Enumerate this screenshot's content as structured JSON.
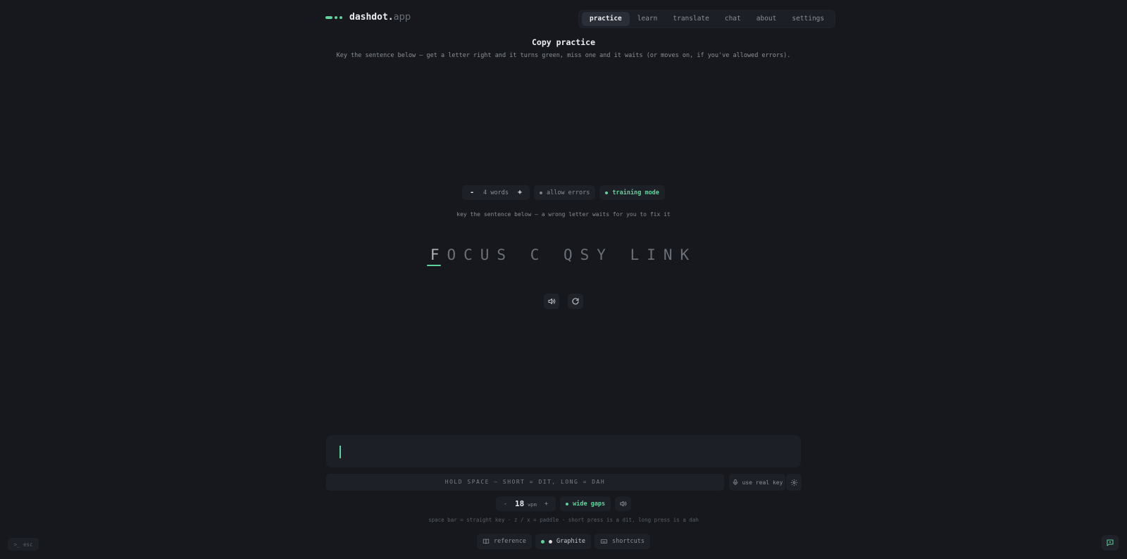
{
  "header": {
    "logo_name": "dashdot.",
    "logo_tld": "app",
    "tabs": [
      {
        "label": "practice",
        "active": true
      },
      {
        "label": "learn"
      },
      {
        "label": "translate"
      },
      {
        "label": "chat"
      },
      {
        "label": "about"
      },
      {
        "label": "settings"
      }
    ]
  },
  "page": {
    "title": "Copy practice",
    "subtitle": "Key the sentence below — get a letter right and it turns green, miss one and it waits (or moves on, if you've allowed errors)."
  },
  "controls": {
    "minus": "-",
    "words": "4 words",
    "plus": "+",
    "allow_errors": "allow errors",
    "training_mode": "training mode"
  },
  "hint": "key the sentence below — a wrong letter waits for you to fix it",
  "sentence": {
    "current": "F",
    "rest": "OCUS C QSY LINK"
  },
  "input": {
    "spacebar_hint": "HOLD SPACE — SHORT = DIT, LONG = DAH",
    "real_key": "use real key"
  },
  "speed": {
    "minus": "-",
    "value": "18",
    "unit": "wpm",
    "plus": "+",
    "wide_gaps": "wide gaps"
  },
  "key_hint": "space bar = straight key · z / x = paddle · short press is a dit, long press is a dah",
  "bottom": {
    "reference": "reference",
    "theme": "Graphite",
    "shortcuts": "shortcuts"
  },
  "esc_label": ">_ esc",
  "colors": {
    "accent": "#5ed39a",
    "background": "#16181d"
  }
}
